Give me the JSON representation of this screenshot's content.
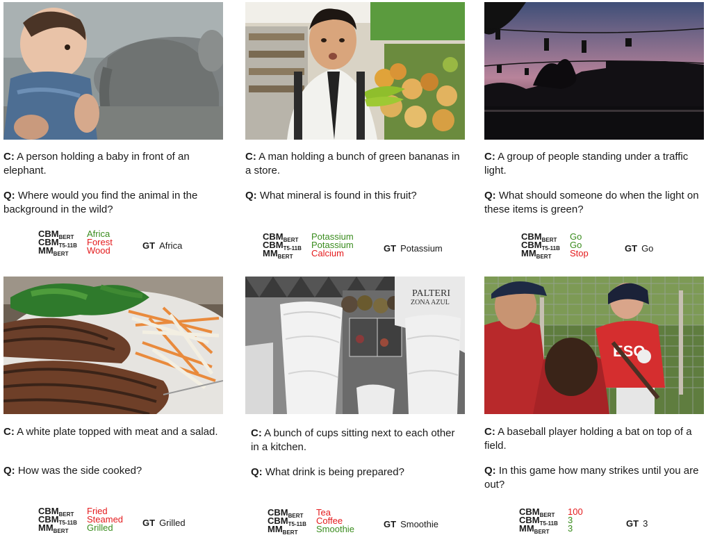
{
  "labels": {
    "caption_prefix": "C:",
    "question_prefix": "Q:",
    "gt_label": "GT"
  },
  "colors": {
    "correct": "#3a8c1e",
    "wrong": "#e41a1c"
  },
  "panels": [
    {
      "caption": "A person holding a baby in front of an elephant.",
      "question": "Where would you find the animal in the background in the wild?",
      "answers": [
        {
          "model": "CBM",
          "sub": "BERT",
          "answer": "Africa",
          "correct": true
        },
        {
          "model": "CBM",
          "sub": "T5-11B",
          "answer": "Forest",
          "correct": false
        },
        {
          "model": "MM",
          "sub": "BERT",
          "answer": "Wood",
          "correct": false
        }
      ],
      "gt": "Africa"
    },
    {
      "caption": "A man holding a bunch of green bananas in a store.",
      "question": "What mineral is found in this fruit?",
      "answers": [
        {
          "model": "CBM",
          "sub": "BERT",
          "answer": "Potassium",
          "correct": true
        },
        {
          "model": "CBM",
          "sub": "T5-11B",
          "answer": "Potassium",
          "correct": true
        },
        {
          "model": "MM",
          "sub": "BERT",
          "answer": "Calcium",
          "correct": false
        }
      ],
      "gt": "Potassium"
    },
    {
      "caption": "A group of people standing under a traffic light.",
      "question": "What should someone do when the light on these items is green?",
      "answers": [
        {
          "model": "CBM",
          "sub": "BERT",
          "answer": "Go",
          "correct": true
        },
        {
          "model": "CBM",
          "sub": "T5-11B",
          "answer": "Go",
          "correct": true
        },
        {
          "model": "MM",
          "sub": "BERT",
          "answer": "Stop",
          "correct": false
        }
      ],
      "gt": "Go"
    },
    {
      "caption": "A white plate topped with meat and a salad.",
      "question": "How was the side cooked?",
      "answers": [
        {
          "model": "CBM",
          "sub": "BERT",
          "answer": "Fried",
          "correct": false
        },
        {
          "model": "CBM",
          "sub": "T5-11B",
          "answer": "Steamed",
          "correct": false
        },
        {
          "model": "MM",
          "sub": "BERT",
          "answer": "Grilled",
          "correct": true
        }
      ],
      "gt": "Grilled"
    },
    {
      "caption": "A bunch of cups sitting next to each other in a kitchen.",
      "question": "What drink is being prepared?",
      "answers": [
        {
          "model": "CBM",
          "sub": "BERT",
          "answer": "Tea",
          "correct": false
        },
        {
          "model": "CBM",
          "sub": "T5-11B",
          "answer": "Coffee",
          "correct": false
        },
        {
          "model": "MM",
          "sub": "BERT",
          "answer": "Smoothie",
          "correct": true
        }
      ],
      "gt": "Smoothie"
    },
    {
      "caption": "A baseball player holding a bat on top of a field.",
      "question": "In this game how many strikes until you are out?",
      "answers": [
        {
          "model": "CBM",
          "sub": "BERT",
          "answer": "100",
          "correct": false
        },
        {
          "model": "CBM",
          "sub": "T5-11B",
          "answer": "3",
          "correct": true
        },
        {
          "model": "MM",
          "sub": "BERT",
          "answer": "3",
          "correct": true
        }
      ],
      "gt": "3"
    }
  ]
}
